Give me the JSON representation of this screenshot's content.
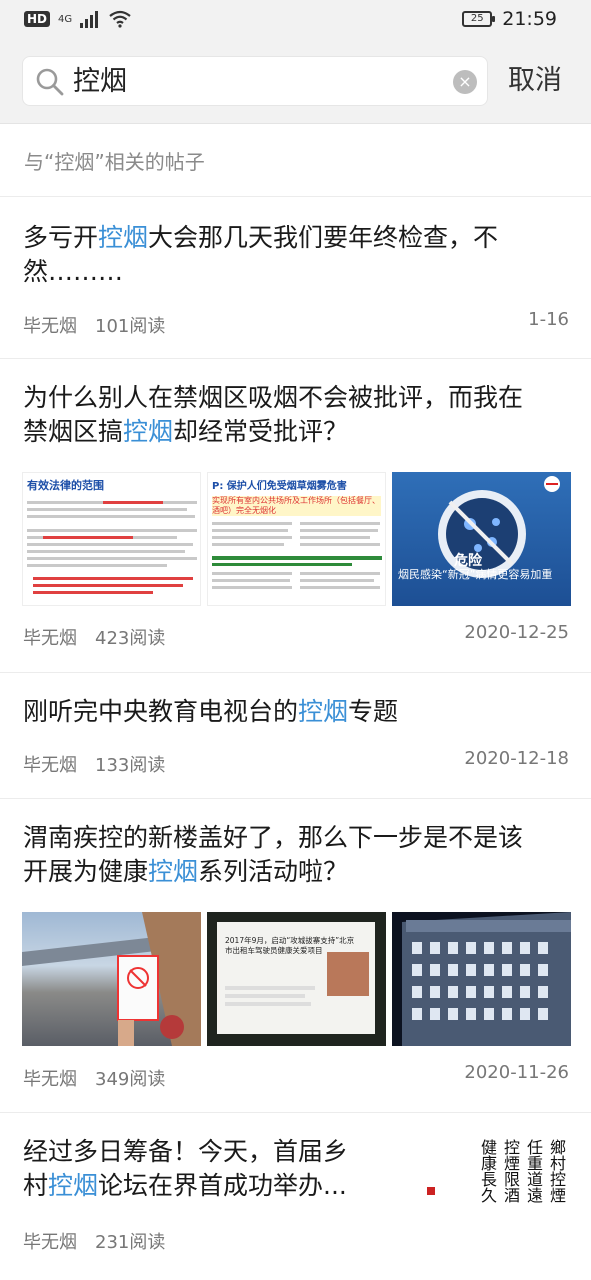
{
  "status_bar": {
    "hd": "HD",
    "network": "4G",
    "battery": "25",
    "time": "21:59"
  },
  "search": {
    "query": "控烟",
    "cancel_label": "取消"
  },
  "section_title": "与“控烟”相关的帖子",
  "posts": [
    {
      "title_pre": "多亏开",
      "title_hl": "控烟",
      "title_post": "大会那几天我们要年终检查，不然………",
      "author": "毕无烟",
      "reads": "101阅读",
      "date": "1-16"
    },
    {
      "title_pre": "为什么别人在禁烟区吸烟不会被批评，而我在禁烟区搞",
      "title_hl": "控烟",
      "title_post": "却经常受批评？",
      "author": "毕无烟",
      "reads": "423阅读",
      "date": "2020-12-25",
      "thumb1": {
        "heading": "有效法律的范围"
      },
      "thumb2": {
        "heading": "P: 保护人们免受烟草烟雾危害",
        "sub": "实现所有室内公共场所及工作场所（包括餐厅、酒吧）完全无烟化"
      },
      "thumb3": {
        "big": "危险",
        "caption": "烟民感染“新冠”病情更容易加重"
      }
    },
    {
      "title_pre": "刚听完中央教育电视台的",
      "title_hl": "控烟",
      "title_post": "专题",
      "author": "毕无烟",
      "reads": "133阅读",
      "date": "2020-12-18"
    },
    {
      "title_pre": "渭南疾控的新楼盖好了，那么下一步是不是该开展为健康",
      "title_hl": "控烟",
      "title_post": "系列活动啦？",
      "author": "毕无烟",
      "reads": "349阅读",
      "date": "2020-11-26",
      "thumb2": {
        "line1": "2017年9月，启动“攻城拔寨支持”北京",
        "line2": "市出租车驾驶员健康关爱项目"
      }
    },
    {
      "title_pre": "经过多日筹备！今天，首届乡村",
      "title_hl": "控烟",
      "title_post": "论坛在界首成功举办...",
      "author": "毕无烟",
      "reads": "231阅读",
      "date": "",
      "calligraphy": [
        "鄉村控煙",
        "任重道遠",
        "控煙限酒",
        "健康長久"
      ]
    }
  ],
  "colors": {
    "highlight": "#3a8fd6",
    "background": "#f2f2f2"
  }
}
